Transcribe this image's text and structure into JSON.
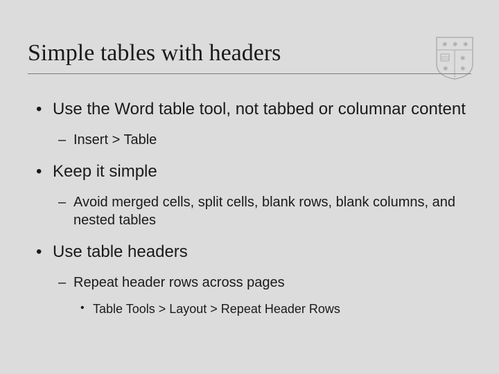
{
  "title": "Simple tables with headers",
  "bullets": [
    {
      "text": "Use the Word table tool, not tabbed or columnar content",
      "sub": [
        {
          "text": "Insert > Table"
        }
      ]
    },
    {
      "text": "Keep it simple",
      "sub": [
        {
          "text": "Avoid merged cells, split cells, blank rows, blank columns, and nested tables"
        }
      ]
    },
    {
      "text": "Use table headers",
      "sub": [
        {
          "text": "Repeat header rows across pages",
          "sub": [
            {
              "text": "Table Tools > Layout > Repeat Header Rows"
            }
          ]
        }
      ]
    }
  ]
}
